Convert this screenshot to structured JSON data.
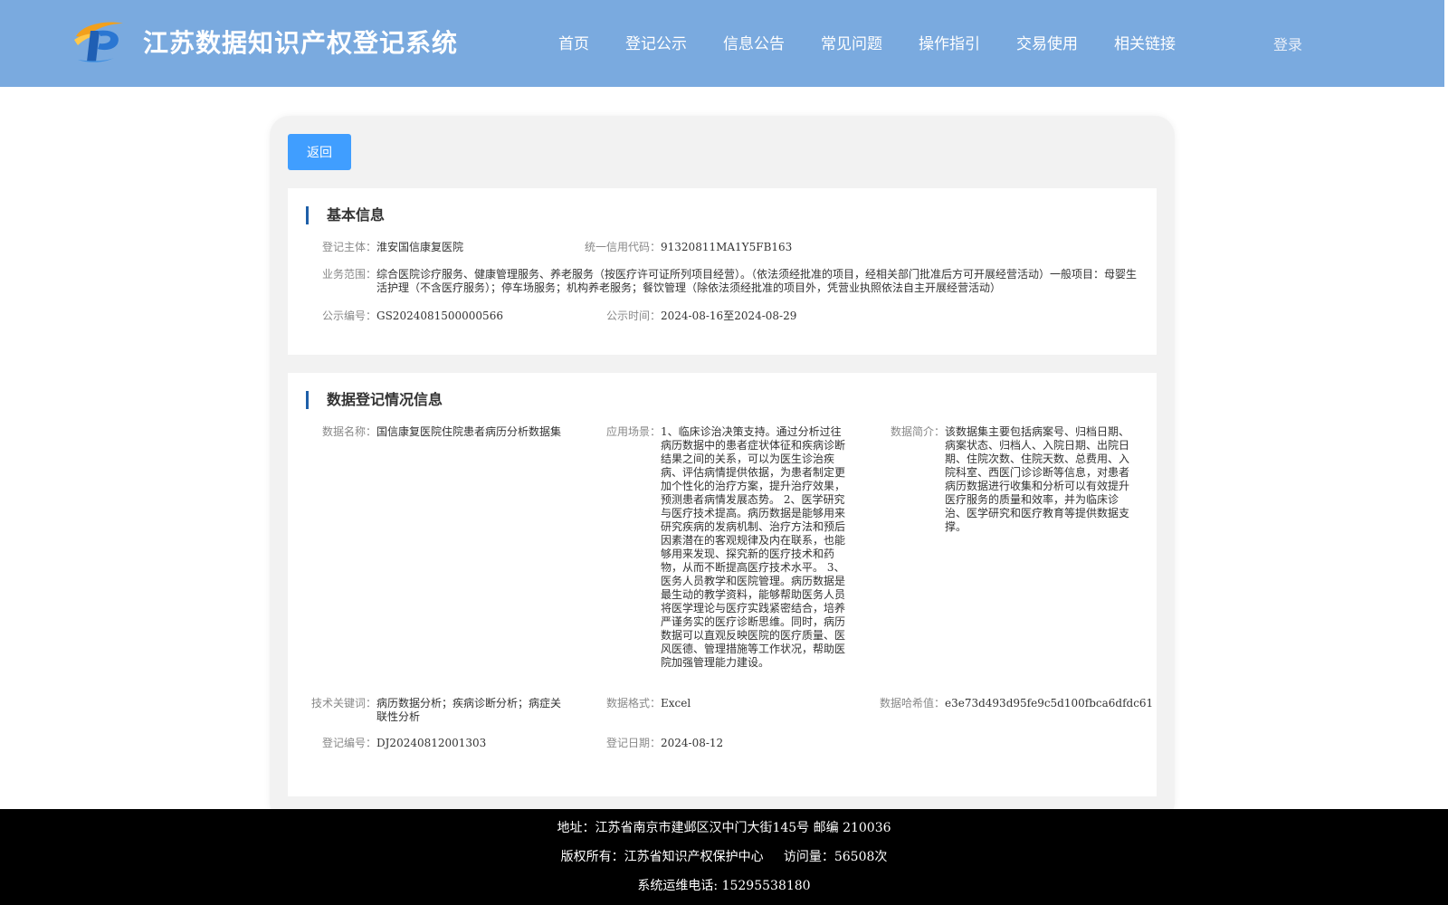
{
  "header": {
    "title": "江苏数据知识产权登记系统",
    "nav": [
      "首页",
      "登记公示",
      "信息公告",
      "常见问题",
      "操作指引",
      "交易使用",
      "相关链接"
    ],
    "login": "登录"
  },
  "back_label": "返回",
  "basic": {
    "section_title": "基本信息",
    "subject_label": "登记主体：",
    "subject": "淮安国信康复医院",
    "credit_label": "统一信用代码：",
    "credit": "91320811MA1Y5FB163",
    "scope_label": "业务范围：",
    "scope": "综合医院诊疗服务、健康管理服务、养老服务（按医疗许可证所列项目经营）。（依法须经批准的项目，经相关部门批准后方可开展经营活动）一般项目：母婴生活护理（不含医疗服务）；停车场服务；机构养老服务；餐饮管理（除依法须经批准的项目外，凭营业执照依法自主开展经营活动）",
    "pub_no_label": "公示编号：",
    "pub_no": "GS2024081500000566",
    "pub_time_label": "公示时间：",
    "pub_time": "2024-08-16至2024-08-29"
  },
  "data": {
    "section_title": "数据登记情况信息",
    "name_label": "数据名称：",
    "name": "国信康复医院住院患者病历分析数据集",
    "scene_label": "应用场景：",
    "scene": "1、临床诊治决策支持。通过分析过往病历数据中的患者症状体征和疾病诊断结果之间的关系，可以为医生诊治疾病、评估病情提供依据，为患者制定更加个性化的治疗方案，提升治疗效果，预测患者病情发展态势。 2、医学研究与医疗技术提高。病历数据是能够用来研究疾病的发病机制、治疗方法和预后因素潜在的客观规律及内在联系，也能够用来发现、探究新的医疗技术和药物，从而不断提高医疗技术水平。 3、医务人员教学和医院管理。病历数据是最生动的教学资料，能够帮助医务人员将医学理论与医疗实践紧密结合，培养严谨务实的医疗诊断思维。同时，病历数据可以直观反映医院的医疗质量、医风医德、管理措施等工作状况，帮助医院加强管理能力建设。",
    "intro_label": "数据简介：",
    "intro": "该数据集主要包括病案号、归档日期、病案状态、归档人、入院日期、出院日期、住院次数、住院天数、总费用、入院科室、西医门诊诊断等信息，对患者病历数据进行收集和分析可以有效提升医疗服务的质量和效率，并为临床诊治、医学研究和医疗教育等提供数据支撑。",
    "keywords_label": "技术关键词：",
    "keywords": "病历数据分析；疾病诊断分析；病症关联性分析",
    "format_label": "数据格式：",
    "format": "Excel",
    "hash_label": "数据哈希值：",
    "hash": "e3e73d493d95fe9c5d100fbca6dfdc61",
    "reg_no_label": "登记编号：",
    "reg_no": "DJ20240812001303",
    "reg_date_label": "登记日期：",
    "reg_date": "2024-08-12"
  },
  "footer": {
    "address": "地址：江苏省南京市建邺区汉中门大街145号 邮编 210036",
    "copyright": "版权所有：江苏省知识产权保护中心     访问量：56508次",
    "phone": "系统运维电话: 15295538180"
  }
}
